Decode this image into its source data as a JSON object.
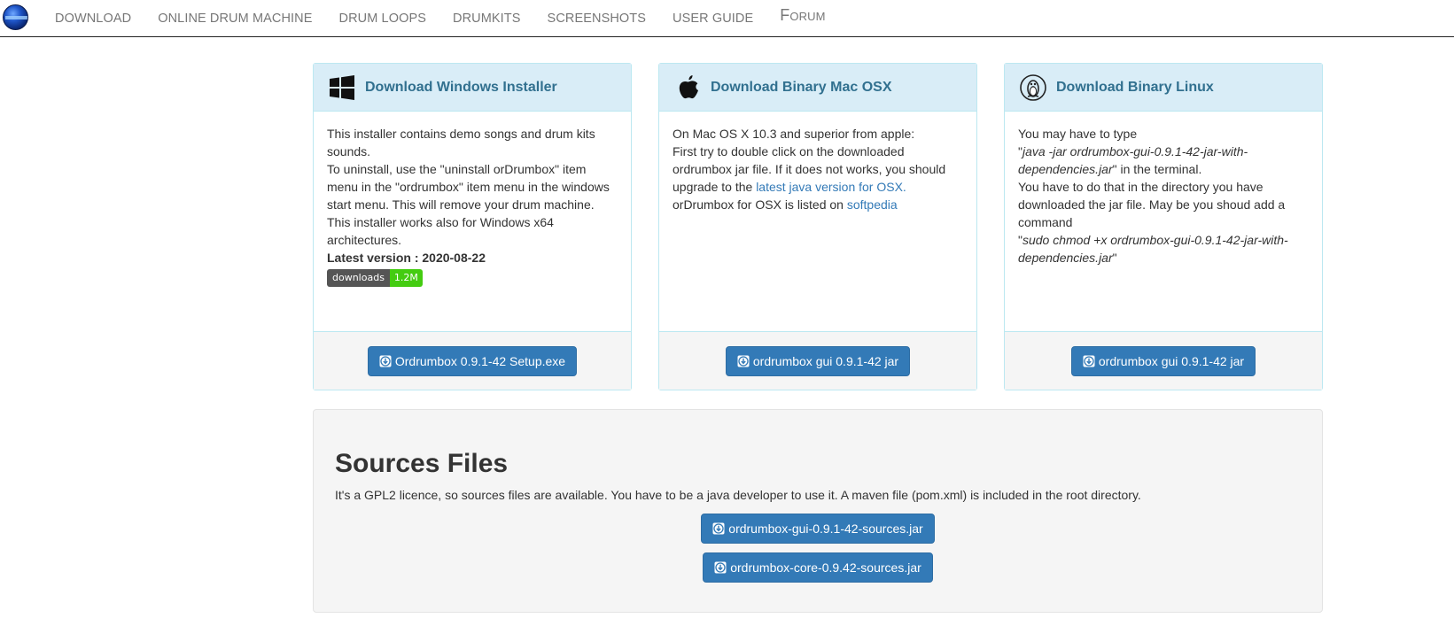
{
  "nav": {
    "items": [
      {
        "label": "Download"
      },
      {
        "label": "Online Drum Machine"
      },
      {
        "label": "Drum Loops"
      },
      {
        "label": "Drumkits"
      },
      {
        "label": "Screenshots"
      },
      {
        "label": "User Guide"
      },
      {
        "label": "Forum"
      }
    ]
  },
  "panels": {
    "windows": {
      "title": "Download Windows Installer",
      "icon": "windows-icon",
      "lines": [
        "This installer contains demo songs and drum kits sounds.",
        "To uninstall, use the \"uninstall orDrumbox\" item menu in the \"ordrumbox\" item menu in the windows start menu. This will remove your drum machine.",
        "This installer works also for Windows x64 architectures."
      ],
      "latest": "Latest version : 2020-08-22",
      "badge_left": "downloads",
      "badge_right": "1.2M",
      "button": "Ordrumbox 0.9.1-42 Setup.exe"
    },
    "mac": {
      "title": "Download Binary Mac OSX",
      "icon": "apple-icon",
      "line1": "On Mac OS X 10.3 and superior from apple:",
      "line2_a": "First try to double click on the downloaded ordrumbox jar file. If it does not works, you should upgrade to the ",
      "line2_link": "latest java version for OSX.",
      "line3_a": "orDrumbox for OSX is listed on ",
      "line3_link": "softpedia",
      "button": "ordrumbox gui 0.9.1-42 jar"
    },
    "linux": {
      "title": "Download Binary Linux",
      "icon": "tux-icon",
      "line1": "You may have to type",
      "cmd1": "java -jar ordrumbox-gui-0.9.1-42-jar-with-dependencies.jar",
      "line2_tail": " in the terminal.",
      "line3": "You have to do that in the directory you have downloaded the jar file. May be you shoud add a command",
      "cmd2": "sudo chmod +x ordrumbox-gui-0.9.1-42-jar-with-dependencies.jar",
      "button": "ordrumbox gui 0.9.1-42 jar"
    }
  },
  "sources": {
    "title": "Sources Files",
    "description": "It's a GPL2 licence, so sources files are available. You have to be a java developer to use it. A maven file (pom.xml) is included in the root directory.",
    "button1": "ordrumbox-gui-0.9.1-42-sources.jar",
    "button2": "ordrumbox-core-0.9.42-sources.jar"
  },
  "colors": {
    "panel_heading_bg": "#d9edf7",
    "panel_title": "#31708f",
    "button_primary": "#337ab7",
    "link": "#337ab7",
    "badge_green": "#44cc11"
  }
}
